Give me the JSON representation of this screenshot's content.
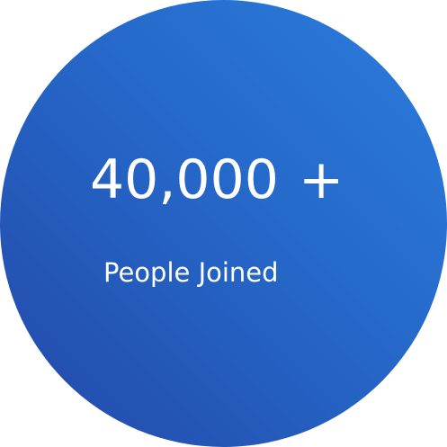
{
  "stat": {
    "value": "40,000",
    "suffix": "+",
    "label": "People Joined"
  },
  "colors": {
    "gradient_dark": "#2348a8",
    "gradient_mid": "#2568c9",
    "gradient_light": "#2b7ddd",
    "text": "#ffffff"
  }
}
